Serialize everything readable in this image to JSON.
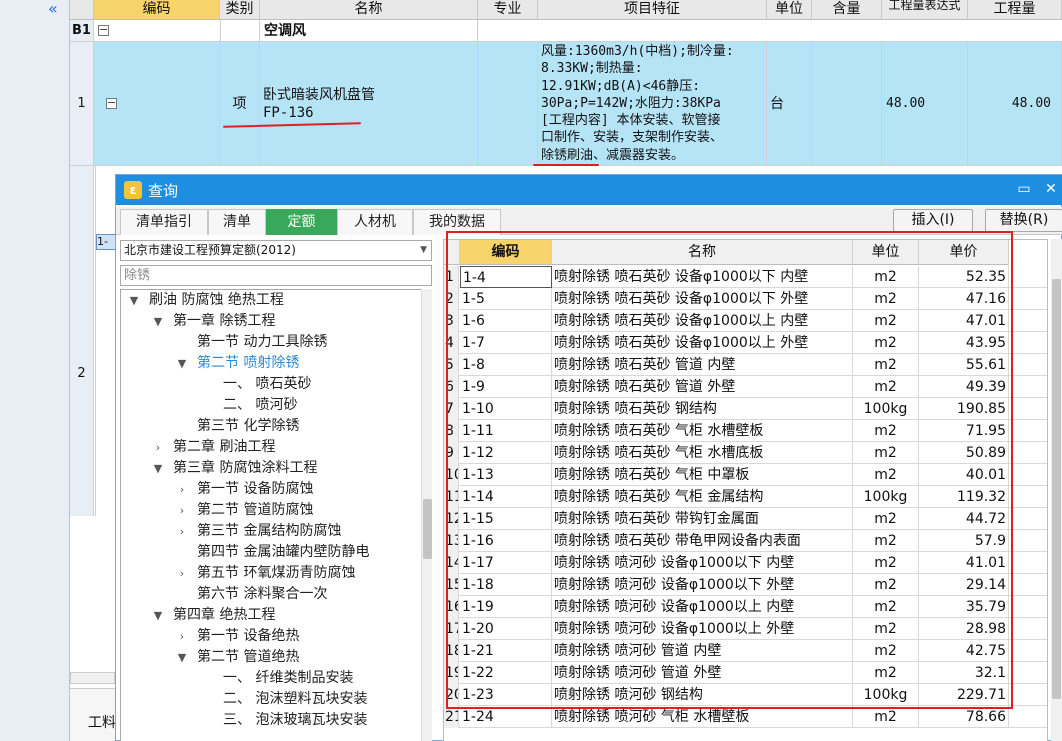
{
  "sheet": {
    "collapse_icon": "double-chevron-left-icon",
    "headers": [
      "编码",
      "类别",
      "名称",
      "专业",
      "项目特征",
      "单位",
      "含量",
      "工程量表达式",
      "工程量"
    ],
    "group_row": {
      "code": "B1",
      "name": "空调风"
    },
    "item_row": {
      "index": "1",
      "type": "项",
      "name_line1": "卧式暗装风机盘管",
      "name_line2": "FP-136",
      "feature_lines": [
        "风量:1360m3/h(中档);制冷量:",
        "8.33KW;制热量:",
        "12.91KW;dB(A)<46静压:",
        "30Pa;P=142W;水阻力:38KPa",
        "[工程内容]  本体安装、软管接",
        "口制作、安装，支架制作安装、",
        "除锈刷油、减震器安装。"
      ],
      "unit": "台",
      "expression": "48.00",
      "quantity": "48.00"
    },
    "row2_index": "2",
    "row2_tag": "1-",
    "bottom_tab": "工料",
    "accent_blue": "#b6e4f7",
    "highlight_color": "#f6d46a"
  },
  "dialog": {
    "title": "查询",
    "tabs": [
      "清单指引",
      "清单",
      "定额",
      "人材机",
      "我的数据"
    ],
    "active_tab": "定额",
    "insert_button": "插入(I)",
    "replace_button": "替换(R)",
    "library": "北京市建设工程预算定额(2012)",
    "search_value": "除锈",
    "tree": [
      {
        "label": "刷油 防腐蚀 绝热工程",
        "toggle": "▼",
        "level": 0
      },
      {
        "label": "第一章 除锈工程",
        "toggle": "▼",
        "level": 1
      },
      {
        "label": "第一节 动力工具除锈",
        "toggle": "",
        "level": 2
      },
      {
        "label": "第二节 喷射除锈",
        "toggle": "▼",
        "level": 2,
        "selected": true
      },
      {
        "label": "一、 喷石英砂",
        "toggle": "",
        "level": 3
      },
      {
        "label": "二、 喷河砂",
        "toggle": "",
        "level": 3
      },
      {
        "label": "第三节 化学除锈",
        "toggle": "",
        "level": 2
      },
      {
        "label": "第二章 刷油工程",
        "toggle": "›",
        "level": 1
      },
      {
        "label": "第三章 防腐蚀涂料工程",
        "toggle": "▼",
        "level": 1
      },
      {
        "label": "第一节 设备防腐蚀",
        "toggle": "›",
        "level": 2
      },
      {
        "label": "第二节 管道防腐蚀",
        "toggle": "›",
        "level": 2
      },
      {
        "label": "第三节 金属结构防腐蚀",
        "toggle": "›",
        "level": 2
      },
      {
        "label": "第四节 金属油罐内壁防静电",
        "toggle": "",
        "level": 2
      },
      {
        "label": "第五节 环氧煤沥青防腐蚀",
        "toggle": "›",
        "level": 2
      },
      {
        "label": "第六节 涂料聚合一次",
        "toggle": "",
        "level": 2
      },
      {
        "label": "第四章 绝热工程",
        "toggle": "▼",
        "level": 1
      },
      {
        "label": "第一节 设备绝热",
        "toggle": "›",
        "level": 2
      },
      {
        "label": "第二节 管道绝热",
        "toggle": "▼",
        "level": 2
      },
      {
        "label": "一、 纤维类制品安装",
        "toggle": "",
        "level": 3
      },
      {
        "label": "二、 泡沫塑料瓦块安装",
        "toggle": "",
        "level": 3
      },
      {
        "label": "三、 泡沫玻璃瓦块安装",
        "toggle": "",
        "level": 3
      }
    ],
    "table": {
      "headers": [
        "编码",
        "名称",
        "单位",
        "单价"
      ],
      "rows": [
        {
          "idx": "1",
          "code": "1-4",
          "name": "喷射除锈 喷石英砂 设备φ1000以下 内壁",
          "unit": "m2",
          "price": "52.35"
        },
        {
          "idx": "2",
          "code": "1-5",
          "name": "喷射除锈 喷石英砂 设备φ1000以下 外壁",
          "unit": "m2",
          "price": "47.16"
        },
        {
          "idx": "3",
          "code": "1-6",
          "name": "喷射除锈 喷石英砂 设备φ1000以上 内壁",
          "unit": "m2",
          "price": "47.01"
        },
        {
          "idx": "4",
          "code": "1-7",
          "name": "喷射除锈 喷石英砂 设备φ1000以上 外壁",
          "unit": "m2",
          "price": "43.95"
        },
        {
          "idx": "5",
          "code": "1-8",
          "name": "喷射除锈 喷石英砂 管道 内壁",
          "unit": "m2",
          "price": "55.61"
        },
        {
          "idx": "6",
          "code": "1-9",
          "name": "喷射除锈 喷石英砂 管道 外壁",
          "unit": "m2",
          "price": "49.39"
        },
        {
          "idx": "7",
          "code": "1-10",
          "name": "喷射除锈 喷石英砂 钢结构",
          "unit": "100kg",
          "price": "190.85"
        },
        {
          "idx": "8",
          "code": "1-11",
          "name": "喷射除锈 喷石英砂 气柜 水槽壁板",
          "unit": "m2",
          "price": "71.95"
        },
        {
          "idx": "9",
          "code": "1-12",
          "name": "喷射除锈 喷石英砂 气柜 水槽底板",
          "unit": "m2",
          "price": "50.89"
        },
        {
          "idx": "10",
          "code": "1-13",
          "name": "喷射除锈 喷石英砂 气柜 中罩板",
          "unit": "m2",
          "price": "40.01"
        },
        {
          "idx": "11",
          "code": "1-14",
          "name": "喷射除锈 喷石英砂 气柜 金属结构",
          "unit": "100kg",
          "price": "119.32"
        },
        {
          "idx": "12",
          "code": "1-15",
          "name": "喷射除锈 喷石英砂 带钩钉金属面",
          "unit": "m2",
          "price": "44.72"
        },
        {
          "idx": "13",
          "code": "1-16",
          "name": "喷射除锈 喷石英砂 带龟甲网设备内表面",
          "unit": "m2",
          "price": "57.9"
        },
        {
          "idx": "14",
          "code": "1-17",
          "name": "喷射除锈 喷河砂 设备φ1000以下 内壁",
          "unit": "m2",
          "price": "41.01"
        },
        {
          "idx": "15",
          "code": "1-18",
          "name": "喷射除锈 喷河砂 设备φ1000以下 外壁",
          "unit": "m2",
          "price": "29.14"
        },
        {
          "idx": "16",
          "code": "1-19",
          "name": "喷射除锈 喷河砂 设备φ1000以上 内壁",
          "unit": "m2",
          "price": "35.79"
        },
        {
          "idx": "17",
          "code": "1-20",
          "name": "喷射除锈 喷河砂 设备φ1000以上 外壁",
          "unit": "m2",
          "price": "28.98"
        },
        {
          "idx": "18",
          "code": "1-21",
          "name": "喷射除锈 喷河砂 管道 内壁",
          "unit": "m2",
          "price": "42.75"
        },
        {
          "idx": "19",
          "code": "1-22",
          "name": "喷射除锈 喷河砂 管道 外壁",
          "unit": "m2",
          "price": "32.1"
        },
        {
          "idx": "20",
          "code": "1-23",
          "name": "喷射除锈 喷河砂 钢结构",
          "unit": "100kg",
          "price": "229.71"
        },
        {
          "idx": "21",
          "code": "1-24",
          "name": "喷射除锈 喷河砂 气柜 水槽壁板",
          "unit": "m2",
          "price": "78.66"
        }
      ]
    },
    "annotation_color": "#e02020",
    "title_color": "#1e8fe0",
    "active_tab_color": "#3aa85a"
  }
}
